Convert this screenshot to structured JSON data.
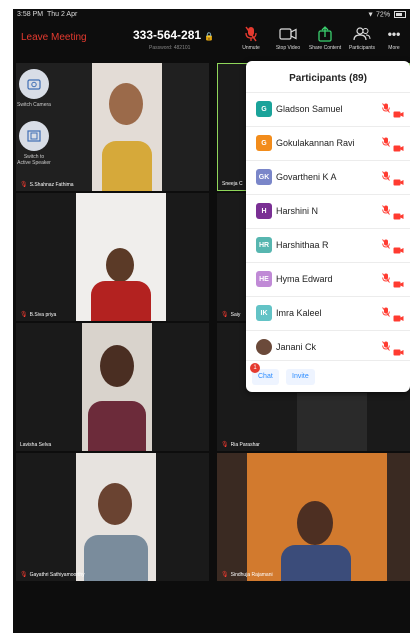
{
  "status": {
    "time": "3:58 PM",
    "date": "Thu 2 Apr",
    "battery": "72%"
  },
  "meeting": {
    "leave_label": "Leave Meeting",
    "id": "333-564-281",
    "password": "Password: 482101"
  },
  "toolbar": {
    "unmute": "Unmute",
    "stop_video": "Stop Video",
    "share_content": "Share Content",
    "participants": "Participants",
    "more": "More"
  },
  "side_controls": {
    "switch_camera": "Switch Camera",
    "switch_speaker": "Switch to Active Speaker"
  },
  "tiles": [
    {
      "name": "S.Shahnaz Fathima"
    },
    {
      "name": "Sneeja C"
    },
    {
      "name": "B.Siva priya"
    },
    {
      "name": "Saiy"
    },
    {
      "name": "Lavisha Selva"
    },
    {
      "name": "Ria Parashar"
    },
    {
      "name": "Gayathri Sathiyamoorthy"
    },
    {
      "name": "Sindhuja Rajamani"
    }
  ],
  "participants": {
    "title": "Participants (89)",
    "list": [
      {
        "initial": "G",
        "name": "Gladson Samuel",
        "color": "#1aa39a"
      },
      {
        "initial": "G",
        "name": "Gokulakannan Ravi",
        "color": "#f28c1b"
      },
      {
        "initial": "GK",
        "name": "Govartheni K A",
        "color": "#7a86c9"
      },
      {
        "initial": "H",
        "name": "Harshini N",
        "color": "#7a2f94"
      },
      {
        "initial": "HR",
        "name": "Harshithaa R",
        "color": "#57b6b0"
      },
      {
        "initial": "HE",
        "name": "Hyma Edward",
        "color": "#c08ad6"
      },
      {
        "initial": "IK",
        "name": "Imra Kaleel",
        "color": "#63c3c6"
      },
      {
        "initial": "",
        "name": "Janani Ck",
        "color": "#6b4a3a"
      }
    ],
    "chat_label": "Chat",
    "chat_badge": "1",
    "invite_label": "Invite"
  },
  "colors": {
    "accent": "#2d8cff",
    "danger": "#e53a2f"
  }
}
